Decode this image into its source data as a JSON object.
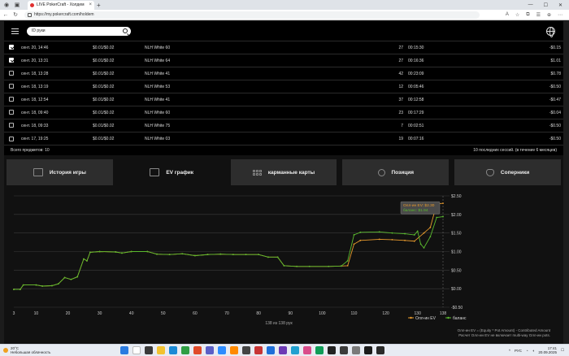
{
  "browser": {
    "tab_title": "LIVE PokerCraft - Холдем",
    "url": "https://my.pokercraft.com/holdem"
  },
  "app": {
    "search": {
      "value": "ID руки"
    },
    "sessions": [
      {
        "checked": true,
        "date": "сент. 20, 14:46",
        "stakes": "$0.01/$0.02",
        "game": "NLH White 60",
        "hands": "27",
        "duration": "00:15:30",
        "result": "-$0.15"
      },
      {
        "checked": true,
        "date": "сент. 20, 13:31",
        "stakes": "$0.01/$0.02",
        "game": "NLH White 64",
        "hands": "27",
        "duration": "00:16:36",
        "result": "$1.01"
      },
      {
        "checked": false,
        "date": "сент. 18, 13:28",
        "stakes": "$0.01/$0.02",
        "game": "NLH White 41",
        "hands": "42",
        "duration": "00:23:09",
        "result": "$0.78"
      },
      {
        "checked": false,
        "date": "сент. 18, 13:19",
        "stakes": "$0.01/$0.02",
        "game": "NLH White 53",
        "hands": "12",
        "duration": "00:05:46",
        "result": "-$0.50"
      },
      {
        "checked": false,
        "date": "сент. 18, 12:54",
        "stakes": "$0.01/$0.02",
        "game": "NLH White 41",
        "hands": "37",
        "duration": "00:12:58",
        "result": "-$0.47"
      },
      {
        "checked": false,
        "date": "сент. 18, 09:40",
        "stakes": "$0.01/$0.02",
        "game": "NLH White 60",
        "hands": "23",
        "duration": "00:17:29",
        "result": "-$0.04"
      },
      {
        "checked": false,
        "date": "сент. 18, 09:33",
        "stakes": "$0.01/$0.02",
        "game": "NLH White 75",
        "hands": "7",
        "duration": "00:02:51",
        "result": "-$0.50"
      },
      {
        "checked": false,
        "date": "сент. 17, 19:25",
        "stakes": "$0.01/$0.02",
        "game": "NLH White 03",
        "hands": "19",
        "duration": "00:07:16",
        "result": "-$0.50"
      }
    ],
    "table_footer": {
      "total": "Всего предметов: 10",
      "recent": "10 последних сессий. (в течение 6 месяцев)"
    },
    "tabs": [
      {
        "label": "История игры",
        "icon": "history-icon",
        "active": false
      },
      {
        "label": "EV график",
        "icon": "chart-icon",
        "active": true
      },
      {
        "label": "карманные карты",
        "icon": "grid-icon",
        "active": false
      },
      {
        "label": "Позиция",
        "icon": "position-icon",
        "active": false
      },
      {
        "label": "Соперники",
        "icon": "opponents-icon",
        "active": false
      }
    ],
    "chart_footer": {
      "hands_count": "138 из 138 рук",
      "note1": "Олл-ин EV = (Equity * Pot Amount) - Contributed Amount",
      "note2": "Расчет Олл-ин EV не включает multi-way Олл-ин pots."
    }
  },
  "chart_data": {
    "type": "line",
    "x_ticks": [
      "3",
      "10",
      "20",
      "30",
      "40",
      "50",
      "60",
      "70",
      "80",
      "90",
      "100",
      "110",
      "120",
      "130",
      "138"
    ],
    "y_ticks": [
      "$2.50",
      "$2.00",
      "$1.50",
      "$1.00",
      "$0.50",
      "$0.00",
      "-$0.50"
    ],
    "xlim": [
      3,
      138
    ],
    "ylim": [
      -0.5,
      2.5
    ],
    "series": [
      {
        "name": "Олл-ин EV",
        "color": "#e89a2c",
        "points": [
          [
            3,
            -0.02
          ],
          [
            5,
            -0.02
          ],
          [
            6,
            0.1
          ],
          [
            10,
            0.1
          ],
          [
            12,
            0.07
          ],
          [
            15,
            0.08
          ],
          [
            17,
            0.13
          ],
          [
            19,
            0.3
          ],
          [
            21,
            0.25
          ],
          [
            23,
            0.32
          ],
          [
            25,
            0.8
          ],
          [
            26,
            0.75
          ],
          [
            27,
            0.98
          ],
          [
            30,
            1.0
          ],
          [
            35,
            0.99
          ],
          [
            37,
            0.96
          ],
          [
            40,
            1.0
          ],
          [
            45,
            1.0
          ],
          [
            48,
            0.93
          ],
          [
            52,
            0.92
          ],
          [
            56,
            0.94
          ],
          [
            60,
            0.89
          ],
          [
            64,
            0.92
          ],
          [
            68,
            0.93
          ],
          [
            72,
            0.92
          ],
          [
            76,
            0.92
          ],
          [
            80,
            0.92
          ],
          [
            83,
            0.85
          ],
          [
            86,
            0.85
          ],
          [
            88,
            0.62
          ],
          [
            92,
            0.6
          ],
          [
            96,
            0.6
          ],
          [
            102,
            0.6
          ],
          [
            106,
            0.61
          ],
          [
            108,
            0.62
          ],
          [
            110,
            1.2
          ],
          [
            112,
            1.3
          ],
          [
            118,
            1.33
          ],
          [
            122,
            1.32
          ],
          [
            126,
            1.3
          ],
          [
            129,
            1.28
          ],
          [
            132,
            1.5
          ],
          [
            134,
            1.65
          ],
          [
            136,
            2.28
          ],
          [
            138,
            2.3
          ]
        ]
      },
      {
        "name": "баланс",
        "color": "#5aba2e",
        "points": [
          [
            3,
            -0.02
          ],
          [
            5,
            -0.02
          ],
          [
            6,
            0.1
          ],
          [
            10,
            0.1
          ],
          [
            12,
            0.07
          ],
          [
            15,
            0.08
          ],
          [
            17,
            0.13
          ],
          [
            19,
            0.3
          ],
          [
            21,
            0.25
          ],
          [
            23,
            0.32
          ],
          [
            25,
            0.8
          ],
          [
            26,
            0.75
          ],
          [
            27,
            0.98
          ],
          [
            30,
            1.0
          ],
          [
            35,
            0.99
          ],
          [
            37,
            0.96
          ],
          [
            40,
            1.0
          ],
          [
            45,
            1.0
          ],
          [
            48,
            0.93
          ],
          [
            52,
            0.92
          ],
          [
            56,
            0.94
          ],
          [
            60,
            0.89
          ],
          [
            64,
            0.92
          ],
          [
            68,
            0.93
          ],
          [
            72,
            0.92
          ],
          [
            76,
            0.92
          ],
          [
            80,
            0.92
          ],
          [
            83,
            0.85
          ],
          [
            86,
            0.85
          ],
          [
            88,
            0.62
          ],
          [
            92,
            0.6
          ],
          [
            96,
            0.6
          ],
          [
            102,
            0.6
          ],
          [
            106,
            0.61
          ],
          [
            108,
            0.75
          ],
          [
            110,
            1.45
          ],
          [
            112,
            1.52
          ],
          [
            118,
            1.53
          ],
          [
            122,
            1.5
          ],
          [
            126,
            1.48
          ],
          [
            129,
            1.45
          ],
          [
            130,
            1.55
          ],
          [
            131,
            1.2
          ],
          [
            132,
            1.1
          ],
          [
            134,
            1.4
          ],
          [
            136,
            1.92
          ],
          [
            138,
            1.94
          ]
        ]
      }
    ],
    "tooltip": {
      "ev_label": "Олл-ин EV: $2.30",
      "balance_label": "баланс: $1.94"
    },
    "legend_position": "bottom-right",
    "grid": true
  },
  "taskbar": {
    "temp": "20°C",
    "weather": "Небольшая облачность",
    "lang": "РУС",
    "time": "17:41",
    "date": "20.09.2025"
  }
}
